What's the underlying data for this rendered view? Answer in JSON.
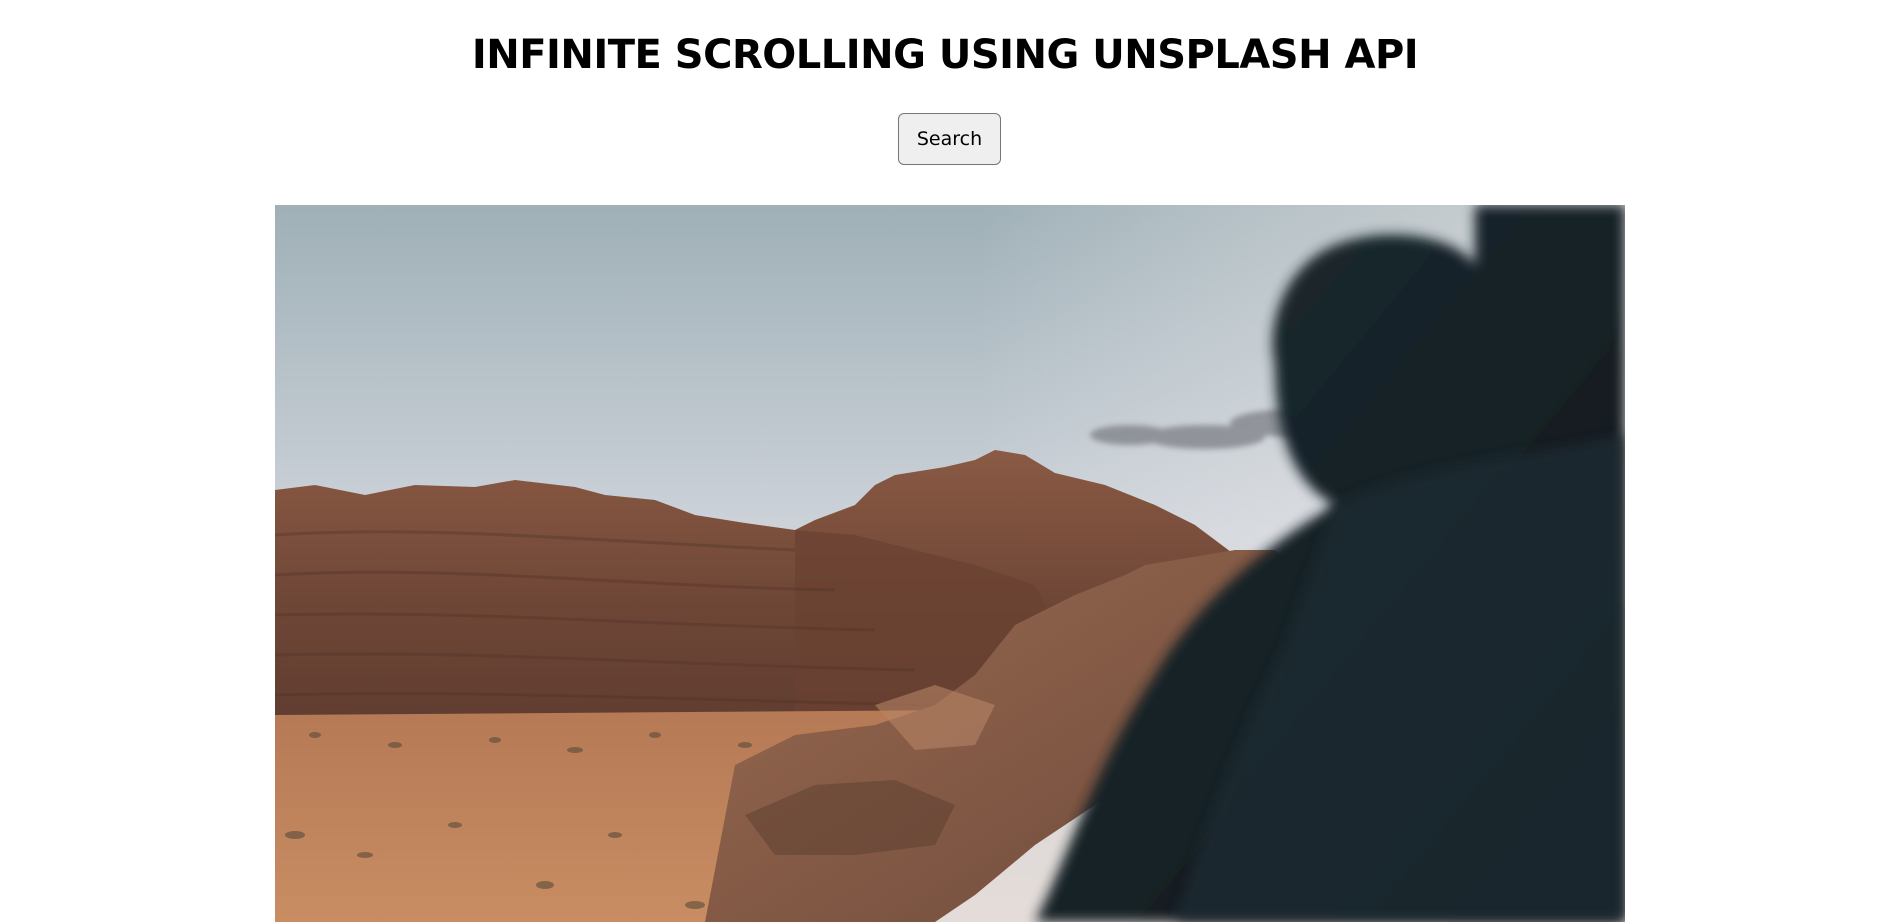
{
  "header": {
    "title": "INFINITE SCROLLING USING UNSPLASH API"
  },
  "search": {
    "button_label": "Search"
  },
  "gallery": {
    "images": [
      {
        "alt": ""
      }
    ]
  },
  "colors": {
    "background": "#ffffff",
    "button_bg": "#efefef",
    "button_border": "#767676",
    "text": "#000000"
  }
}
